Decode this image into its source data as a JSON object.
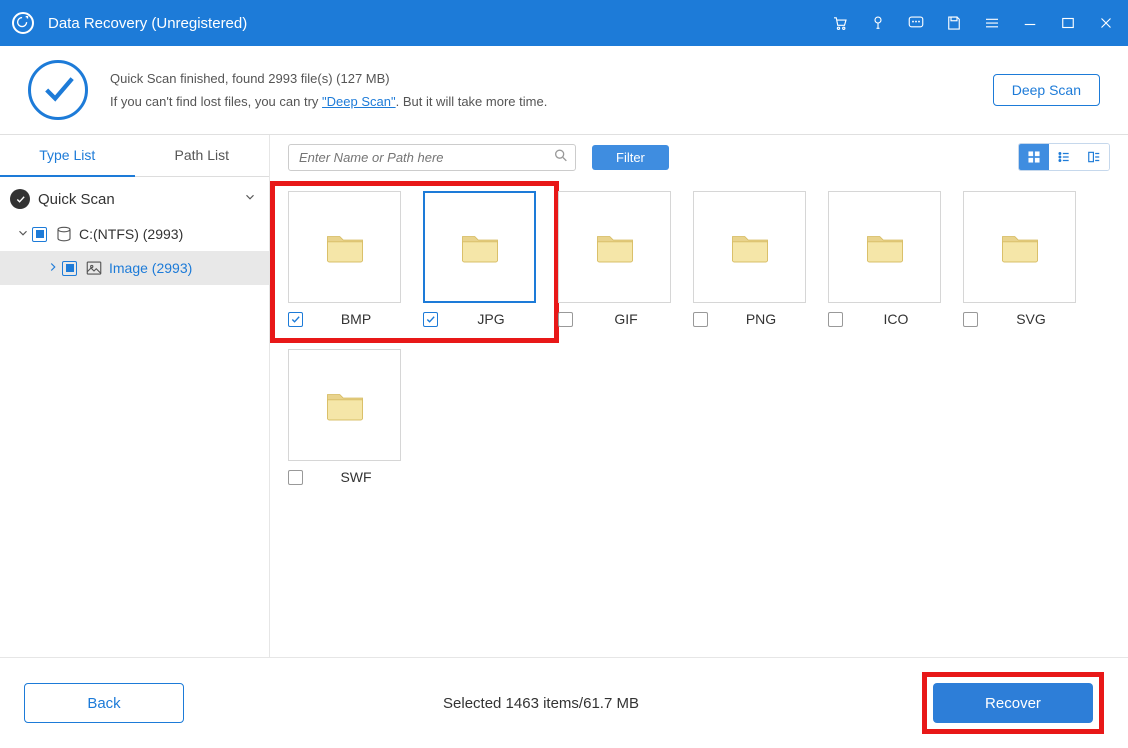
{
  "title": "Data Recovery (Unregistered)",
  "summary": {
    "line1": "Quick Scan finished, found 2993 file(s) (127 MB)",
    "line2a": "If you can't find lost files, you can try ",
    "deep_link": "\"Deep Scan\"",
    "line2b": ". But it will take more time."
  },
  "deep_scan_btn": "Deep Scan",
  "tabs": {
    "type_list": "Type List",
    "path_list": "Path List"
  },
  "tree": {
    "quick_scan": "Quick Scan",
    "drive": "C:(NTFS) (2993)",
    "image": "Image (2993)"
  },
  "search_placeholder": "Enter Name or Path here",
  "filter_btn": "Filter",
  "cards": [
    {
      "label": "BMP",
      "checked": true
    },
    {
      "label": "JPG",
      "checked": true,
      "selected": true
    },
    {
      "label": "GIF",
      "checked": false
    },
    {
      "label": "PNG",
      "checked": false
    },
    {
      "label": "ICO",
      "checked": false
    },
    {
      "label": "SVG",
      "checked": false
    },
    {
      "label": "SWF",
      "checked": false
    }
  ],
  "footer": {
    "back": "Back",
    "selected": "Selected 1463 items/61.7 MB",
    "recover": "Recover"
  }
}
